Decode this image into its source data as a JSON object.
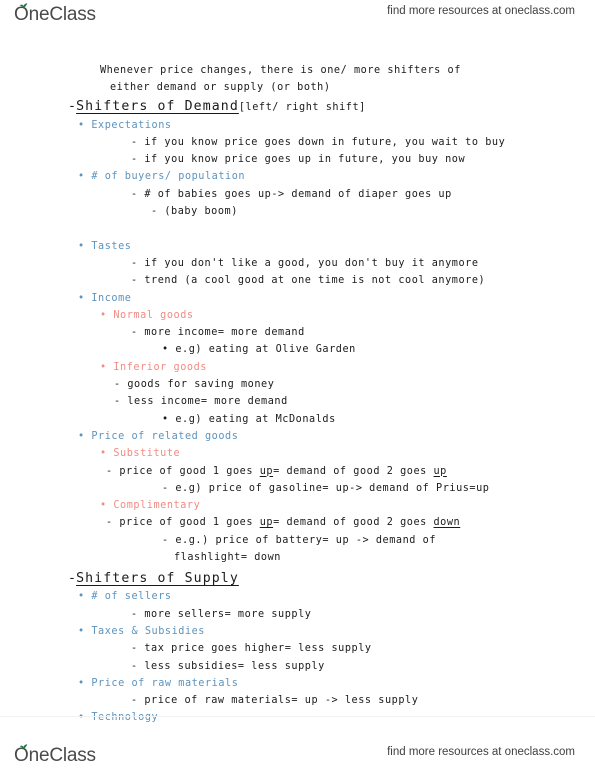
{
  "brand": {
    "name": "OneClass",
    "promo": "find more resources at oneclass.com",
    "leaf_color": "#1f7a45",
    "wordmark_color": "#4a4a4a"
  },
  "colors": {
    "body_text": "#1b1b1b",
    "level1_bullet": "#5d93bd",
    "level2_bullet": "#f28b84"
  },
  "document": {
    "intro": [
      "Whenever price changes, there is one/ more shifters of",
      "either demand or supply (or both)"
    ],
    "section_demand": {
      "dash": "-",
      "title": "Shifters of Demand",
      "subtitle": "[left/ right shift]"
    },
    "section_supply": {
      "dash": "-",
      "title": "Shifters of Supply",
      "subtitle": ""
    },
    "demand_items": {
      "expectations": "Expectations",
      "expectations_a": "- if you know price goes down in future, you wait to buy",
      "expectations_b": "- if you know price goes up in future, you buy now",
      "buyers": "# of buyers/ population",
      "buyers_a": "- # of babies goes up-> demand of diaper goes up",
      "buyers_b": "- (baby boom)",
      "tastes": "Tastes",
      "tastes_a": "- if you don't like a good, you don't buy it anymore",
      "tastes_b": "- trend (a cool good at one time is not cool anymore)",
      "income": "Income",
      "normal_goods": "Normal goods",
      "normal_a": "- more income= more demand",
      "normal_b": "• e.g) eating at Olive Garden",
      "inferior_goods": "Inferior goods",
      "inferior_a": "- goods for saving money",
      "inferior_b": "- less income= more demand",
      "inferior_c": "• e.g) eating at McDonalds",
      "related_goods": "Price of related goods",
      "substitute": "Substitute",
      "substitute_a_p1": "- price of good 1 goes ",
      "substitute_a_u1": "up",
      "substitute_a_p2": "= demand of good 2 goes ",
      "substitute_a_u2": "up",
      "substitute_b": "- e.g) price of gasoline= up-> demand of Prius=up",
      "complimentary": "Complimentary",
      "complimentary_a_p1": "- price of good 1 goes ",
      "complimentary_a_u1": "up",
      "complimentary_a_p2": "= demand of good 2 goes ",
      "complimentary_a_u2": "down",
      "complimentary_b": "- e.g.) price of battery= up -> demand of",
      "complimentary_c": "flashlight= down"
    },
    "supply_items": {
      "sellers": "# of sellers",
      "sellers_a": "- more sellers= more supply",
      "taxes": "Taxes & Subsidies",
      "taxes_a": "- tax price goes higher= less supply",
      "taxes_b": "- less subsidies= less supply",
      "raw_materials": "Price of raw materials",
      "raw_a": "- price of raw materials= up -> less supply",
      "technology": "Technology"
    },
    "bullets": {
      "level1": "•",
      "level2": "•"
    }
  }
}
